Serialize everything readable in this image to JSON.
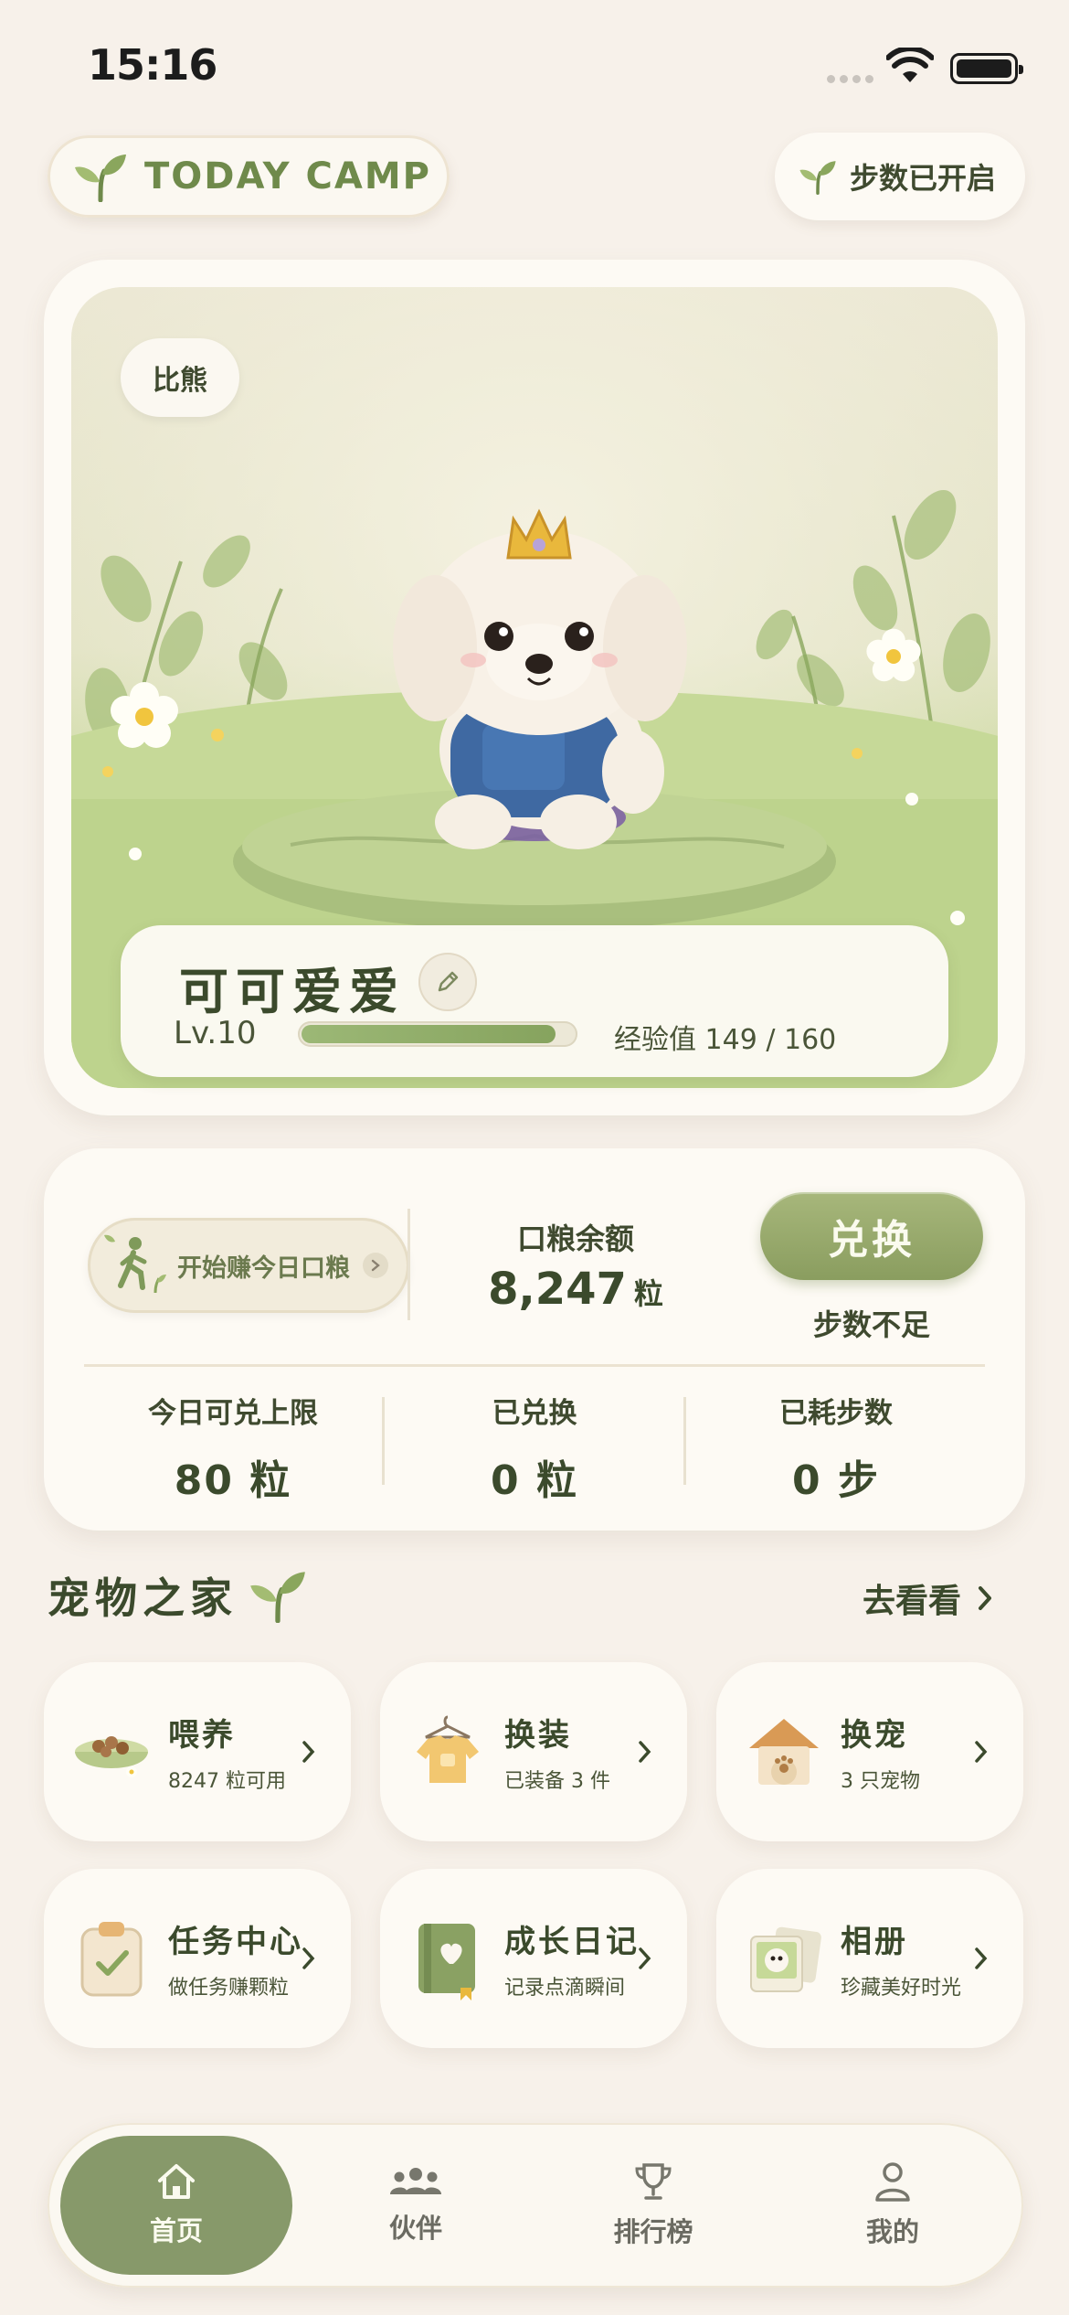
{
  "status_bar": {
    "time": "15:16"
  },
  "header": {
    "brand": "TODAY CAMP",
    "steps_status": "步数已开启"
  },
  "pet": {
    "breed": "比熊",
    "name": "可可爱爱",
    "level": "Lv.10",
    "xp_text": "经验值 149 / 160",
    "xp_current": 149,
    "xp_max": 160
  },
  "food": {
    "earn_label": "开始赚今日口粮",
    "balance_label": "口粮余额",
    "balance_value": "8,247",
    "balance_unit": "粒",
    "exchange_label": "兑换",
    "exchange_note": "步数不足",
    "stats": [
      {
        "label": "今日可兑上限",
        "value": "80 粒"
      },
      {
        "label": "已兑换",
        "value": "0 粒"
      },
      {
        "label": "已耗步数",
        "value": "0 步"
      }
    ]
  },
  "pet_home": {
    "title": "宠物之家",
    "see_more": "去看看",
    "tiles": [
      {
        "title": "喂养",
        "subtitle": "8247 粒可用",
        "icon": "food-bowl-icon"
      },
      {
        "title": "换装",
        "subtitle": "已装备 3 件",
        "icon": "outfit-icon"
      },
      {
        "title": "换宠",
        "subtitle": "3 只宠物",
        "icon": "pet-house-icon"
      },
      {
        "title": "任务中心",
        "subtitle": "做任务赚颗粒",
        "icon": "clipboard-check-icon"
      },
      {
        "title": "成长日记",
        "subtitle": "记录点滴瞬间",
        "icon": "diary-book-icon"
      },
      {
        "title": "相册",
        "subtitle": "珍藏美好时光",
        "icon": "photo-album-icon"
      }
    ]
  },
  "tabbar": {
    "items": [
      {
        "label": "首页",
        "icon": "home-icon",
        "active": true
      },
      {
        "label": "伙伴",
        "icon": "friends-icon",
        "active": false
      },
      {
        "label": "排行榜",
        "icon": "trophy-icon",
        "active": false
      },
      {
        "label": "我的",
        "icon": "profile-icon",
        "active": false
      }
    ]
  },
  "colors": {
    "background": "#f7f1ea",
    "accent_green": "#87996a",
    "text_dark": "#3b4a2c"
  }
}
